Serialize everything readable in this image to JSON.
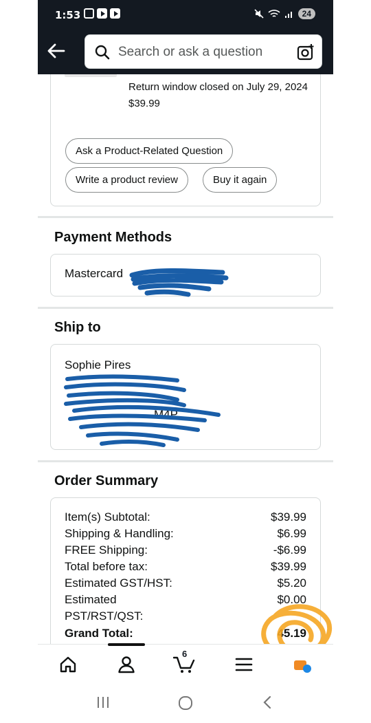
{
  "status_bar": {
    "time": "1:53",
    "battery": "24"
  },
  "header": {
    "search_placeholder": "Search or ask a question"
  },
  "item": {
    "return_window": "Return window closed on July 29, 2024",
    "price": "$39.99",
    "buttons": {
      "ask_question": "Ask a Product-Related Question",
      "write_review": "Write a product review",
      "buy_again": "Buy it again"
    }
  },
  "payment": {
    "title": "Payment Methods",
    "card": "Mastercard"
  },
  "ship_to": {
    "title": "Ship to",
    "name": "Sophie Pires",
    "partial_postal": "M4P"
  },
  "order_summary": {
    "title": "Order Summary",
    "rows": [
      {
        "label": "Item(s) Subtotal:",
        "value": "$39.99"
      },
      {
        "label": "Shipping & Handling:",
        "value": "$6.99"
      },
      {
        "label": "FREE Shipping:",
        "value": "-$6.99"
      },
      {
        "label": "Total before tax:",
        "value": "$39.99"
      },
      {
        "label": "Estimated GST/HST:",
        "value": "$5.20"
      },
      {
        "label": "Estimated",
        "label2": "PST/RST/QST:",
        "value": "$0.00"
      },
      {
        "label": "Grand Total:",
        "value": "45.19"
      }
    ]
  },
  "bottom_nav": {
    "cart_count": "6"
  },
  "colors": {
    "header_bg": "#131921",
    "scribble_blue": "#1a5ea8",
    "scribble_orange": "#f5a623"
  }
}
